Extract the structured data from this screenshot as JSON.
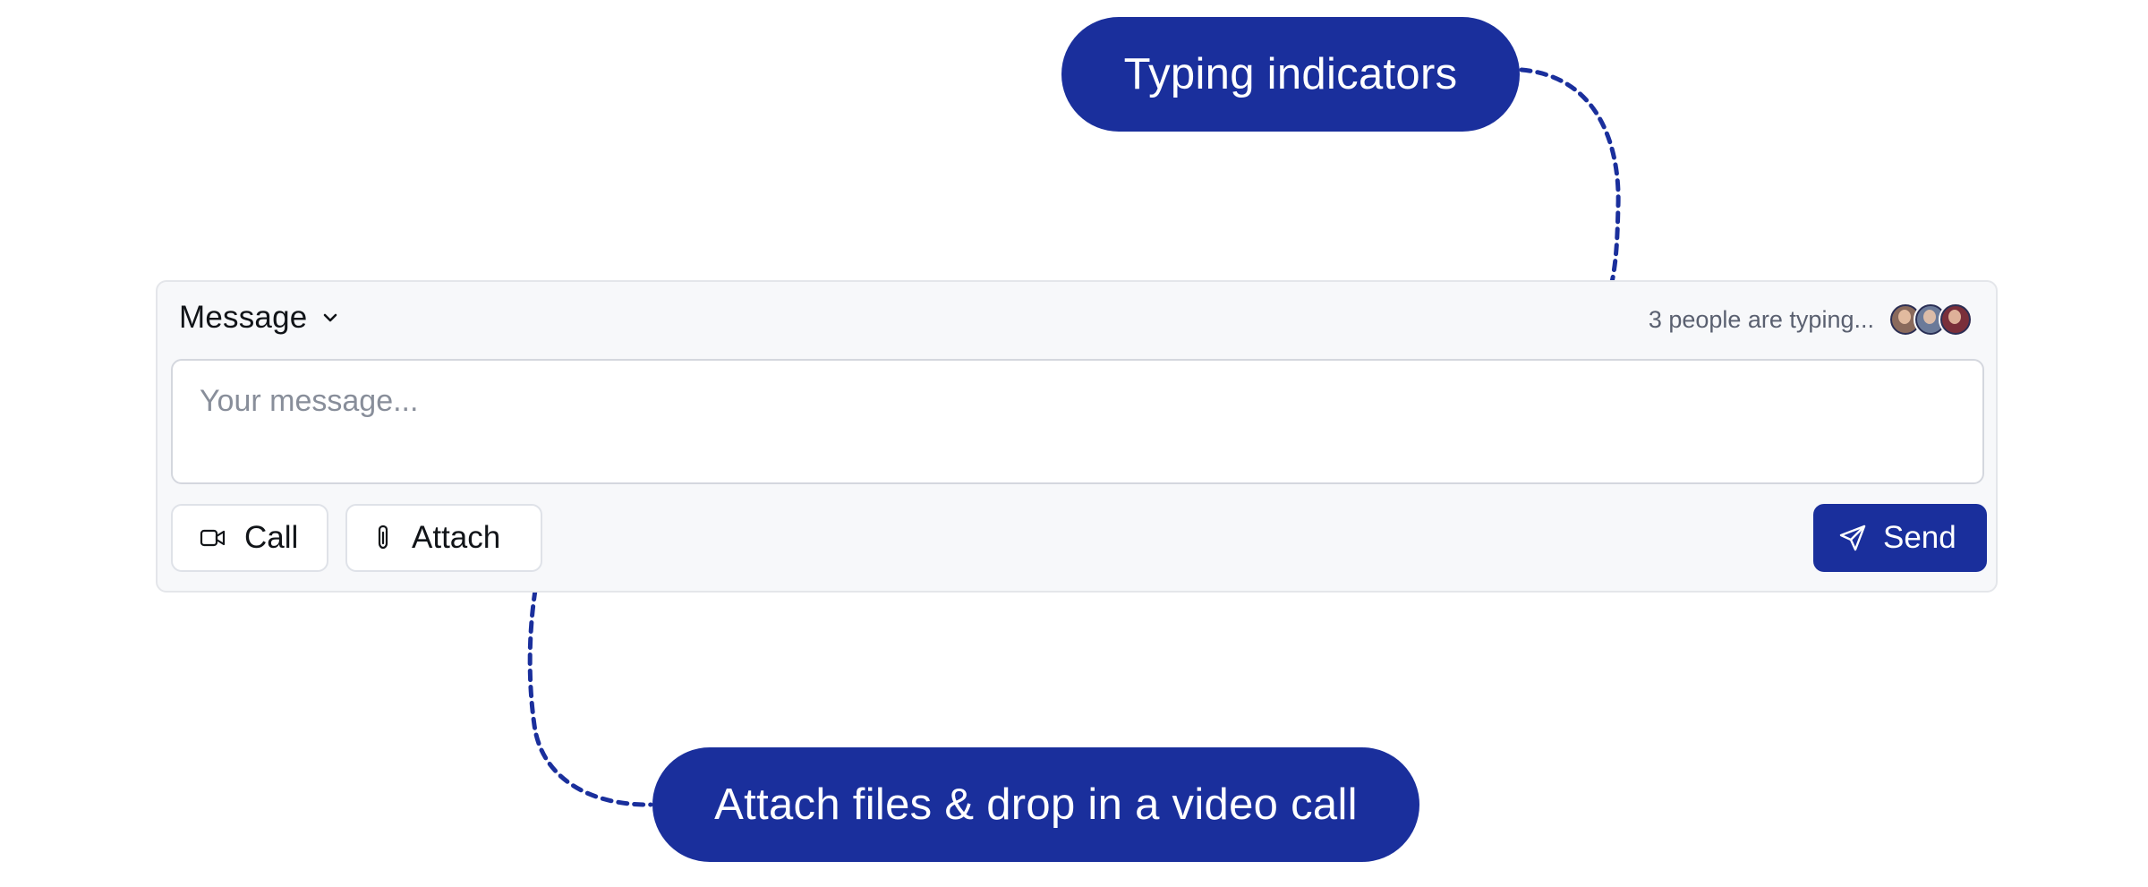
{
  "composer": {
    "mode_label": "Message",
    "typing_text": "3 people are typing...",
    "avatars": [
      "avatar-1",
      "avatar-2",
      "avatar-3"
    ],
    "message_placeholder": "Your message...",
    "message_value": "",
    "call_label": "Call",
    "attach_label": "Attach",
    "send_label": "Send"
  },
  "callouts": {
    "typing": "Typing indicators",
    "attach": "Attach files & drop in a video call"
  },
  "colors": {
    "accent": "#1a2f9c",
    "card_background": "#f7f8fa",
    "border": "#dfe2e8",
    "muted_text": "#5a6070",
    "placeholder_text": "#888e9a"
  },
  "icons": {
    "mode_dropdown": "chevron-down-icon",
    "call": "video-camera-icon",
    "attach": "paperclip-icon",
    "send": "paper-plane-icon"
  }
}
